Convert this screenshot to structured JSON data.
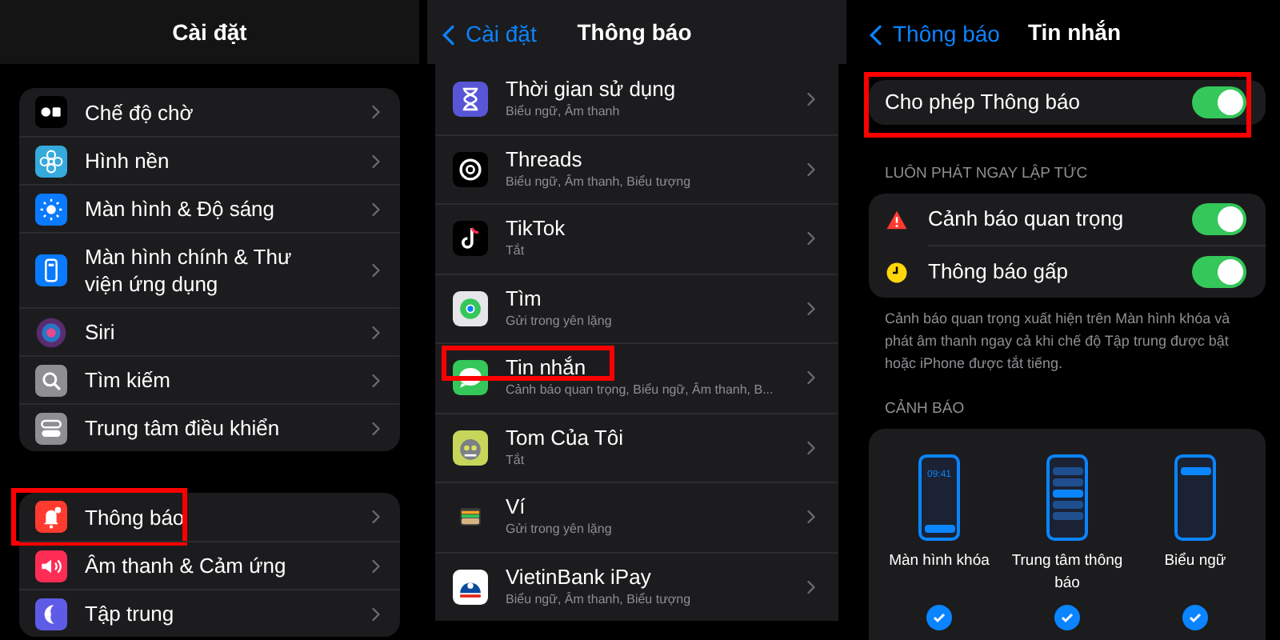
{
  "panels": [
    {
      "title": "Cài đặt",
      "groups": [
        {
          "items": [
            {
              "label": "Chế độ chờ",
              "highlighted": false
            },
            {
              "label": "Hình nền",
              "highlighted": false
            },
            {
              "label": "Màn hình & Độ sáng",
              "highlighted": false
            },
            {
              "label": "Màn hình chính & Thư viện ứng dụng",
              "highlighted": false
            },
            {
              "label": "Siri",
              "highlighted": false
            },
            {
              "label": "Tìm kiếm",
              "highlighted": false
            },
            {
              "label": "Trung tâm điều khiển",
              "highlighted": false
            }
          ]
        },
        {
          "items": [
            {
              "label": "Thông báo",
              "highlighted": true
            },
            {
              "label": "Âm thanh & Cảm ứng",
              "highlighted": false
            },
            {
              "label": "Tập trung",
              "highlighted": false
            }
          ]
        }
      ]
    },
    {
      "back": "Cài đặt",
      "title": "Thông báo",
      "apps": [
        {
          "name": "Thời gian sử dụng",
          "detail": "Biểu ngữ, Âm thanh",
          "highlighted": false
        },
        {
          "name": "Threads",
          "detail": "Biểu ngữ, Âm thanh, Biểu tượng",
          "highlighted": false
        },
        {
          "name": "TikTok",
          "detail": "Tắt",
          "highlighted": false
        },
        {
          "name": "Tìm",
          "detail": "Gửi trong yên lặng",
          "highlighted": false
        },
        {
          "name": "Tin nhắn",
          "detail": "Cảnh báo quan trọng, Biểu ngữ, Âm thanh, B...",
          "highlighted": true
        },
        {
          "name": "Tom Của Tôi",
          "detail": "Tắt",
          "highlighted": false
        },
        {
          "name": "Ví",
          "detail": "Gửi trong yên lặng",
          "highlighted": false
        },
        {
          "name": "VietinBank iPay",
          "detail": "Biểu ngữ, Âm thanh, Biểu tượng",
          "highlighted": false
        }
      ]
    },
    {
      "back": "Thông báo",
      "title": "Tin nhắn",
      "allow": {
        "label": "Cho phép Thông báo",
        "on": true,
        "highlighted": true
      },
      "immediate_header": "LUÔN PHÁT NGAY LẬP TỨC",
      "immediate": [
        {
          "label": "Cảnh báo quan trọng",
          "on": true
        },
        {
          "label": "Thông báo gấp",
          "on": true
        }
      ],
      "footnote": "Cảnh báo quan trọng xuất hiện trên Màn hình khóa và phát âm thanh ngay cả khi chế độ Tập trung được bật hoặc iPhone được tắt tiếng.",
      "alerts_header": "CẢNH BÁO",
      "alerts": [
        {
          "label": "Màn hình khóa",
          "time": "09:41",
          "checked": true
        },
        {
          "label": "Trung tâm thông báo",
          "checked": true
        },
        {
          "label": "Biểu ngữ",
          "checked": true
        }
      ]
    }
  ]
}
